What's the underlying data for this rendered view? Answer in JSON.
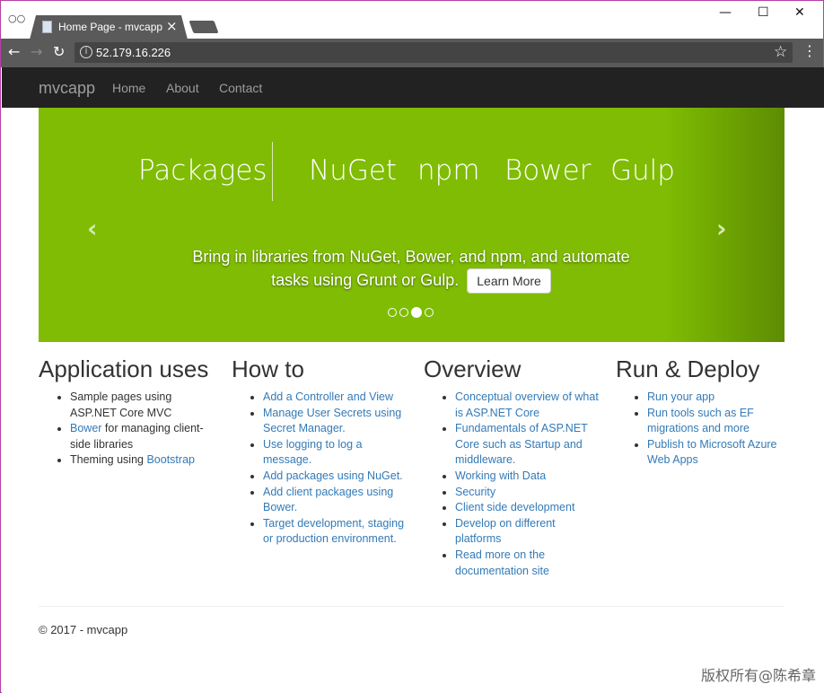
{
  "browser": {
    "tab_title": "Home Page - mvcapp",
    "url": "52.179.16.226",
    "window_controls": {
      "minimize": "—",
      "maximize": "☐",
      "close": "✕"
    },
    "icons": [
      "incognito-icon",
      "page-icon",
      "back-icon",
      "forward-icon",
      "reload-icon",
      "info-icon",
      "star-icon",
      "menu-icon"
    ]
  },
  "navbar": {
    "brand": "mvcapp",
    "links": [
      "Home",
      "About",
      "Contact"
    ]
  },
  "carousel": {
    "background": "#7fbc03",
    "slide_titles": [
      "Packages",
      "NuGet",
      "npm",
      "Bower",
      "Gulp"
    ],
    "caption": "Bring in libraries from NuGet, Bower, and npm, and automate tasks using Grunt or Gulp.",
    "button": "Learn More",
    "prev_arrow": "‹",
    "next_arrow": "›",
    "slide_count": 4,
    "active_slide": 3
  },
  "sections": [
    {
      "title": "Application uses",
      "items": [
        {
          "pre": "Sample pages using ASP.NET Core MVC",
          "link": "",
          "post": ""
        },
        {
          "pre": "",
          "link": "Bower",
          "post": " for managing client-side libraries"
        },
        {
          "pre": "Theming using ",
          "link": "Bootstrap",
          "post": ""
        }
      ]
    },
    {
      "title": "How to",
      "items": [
        {
          "pre": "",
          "link": "Add a Controller and View",
          "post": ""
        },
        {
          "pre": "",
          "link": "Manage User Secrets using Secret Manager.",
          "post": ""
        },
        {
          "pre": "",
          "link": "Use logging to log a message.",
          "post": ""
        },
        {
          "pre": "",
          "link": "Add packages using NuGet.",
          "post": ""
        },
        {
          "pre": "",
          "link": "Add client packages using Bower.",
          "post": ""
        },
        {
          "pre": "",
          "link": "Target development, staging or production environment.",
          "post": ""
        }
      ]
    },
    {
      "title": "Overview",
      "items": [
        {
          "pre": "",
          "link": "Conceptual overview of what is ASP.NET Core",
          "post": ""
        },
        {
          "pre": "",
          "link": "Fundamentals of ASP.NET Core such as Startup and middleware.",
          "post": ""
        },
        {
          "pre": "",
          "link": "Working with Data",
          "post": ""
        },
        {
          "pre": "",
          "link": "Security",
          "post": ""
        },
        {
          "pre": "",
          "link": "Client side development",
          "post": ""
        },
        {
          "pre": "",
          "link": "Develop on different platforms",
          "post": ""
        },
        {
          "pre": "",
          "link": "Read more on the documentation site",
          "post": ""
        }
      ]
    },
    {
      "title": "Run & Deploy",
      "items": [
        {
          "pre": "",
          "link": "Run your app",
          "post": ""
        },
        {
          "pre": "",
          "link": "Run tools such as EF migrations and more",
          "post": ""
        },
        {
          "pre": "",
          "link": "Publish to Microsoft Azure Web Apps",
          "post": ""
        }
      ]
    }
  ],
  "footer": "© 2017 - mvcapp",
  "watermark": "版权所有@陈希章",
  "colors": {
    "navbar": "#222222",
    "link": "#337ab7",
    "carousel_green": "#7fbc03"
  }
}
